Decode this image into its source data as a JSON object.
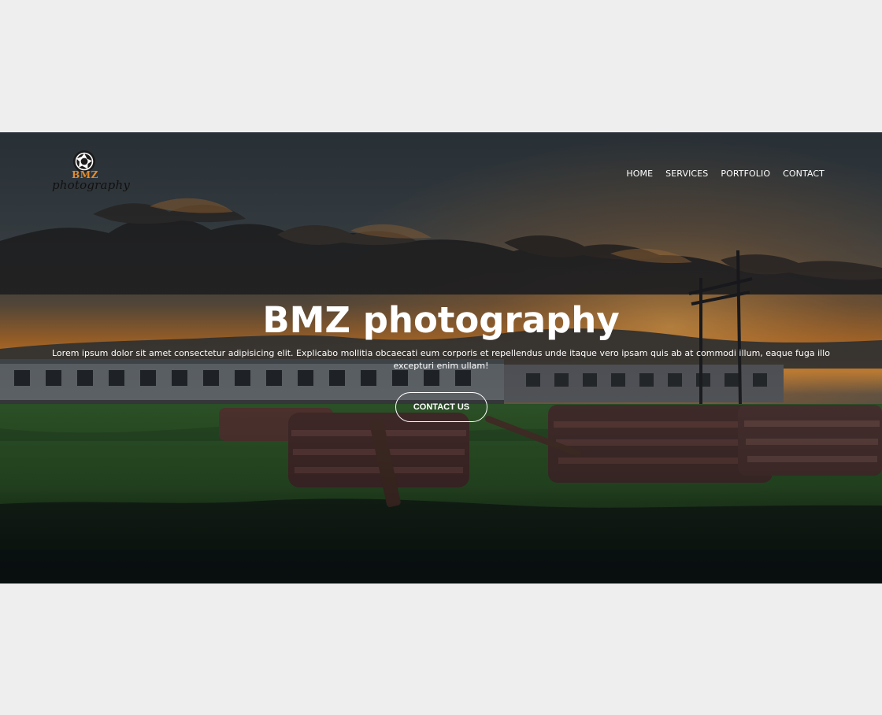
{
  "brand": {
    "title": "BMZ",
    "subtitle": "photography"
  },
  "nav": {
    "items": [
      {
        "label": "HOME"
      },
      {
        "label": "SERVICES"
      },
      {
        "label": "PORTFOLIO"
      },
      {
        "label": "CONTACT"
      }
    ]
  },
  "hero": {
    "title": "BMZ photography",
    "description": "Lorem ipsum dolor sit amet consectetur adipisicing elit. Explicabo mollitia obcaecati eum corporis et repellendus unde itaque vero ipsam quis ab at commodi illum, eaque fuga illo excepturi enim ullam!",
    "cta_label": "CONTACT US"
  },
  "colors": {
    "page_background": "#eeeeee",
    "brand_accent": "#e38b2d",
    "hero_text": "#ffffff"
  },
  "icons": {
    "logo": "camera-aperture-icon"
  }
}
